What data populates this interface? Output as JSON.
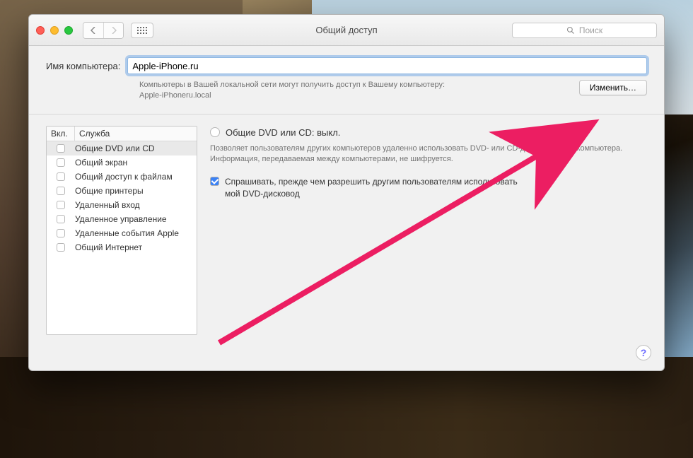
{
  "titlebar": {
    "title": "Общий доступ",
    "search_placeholder": "Поиск"
  },
  "computer": {
    "label": "Имя компьютера:",
    "value": "Apple-iPhone.ru",
    "description": "Компьютеры в Вашей локальной сети могут получить доступ к Вашему компьютеру: Apple-iPhoneru.local",
    "change_button": "Изменить…"
  },
  "list": {
    "header_on": "Вкл.",
    "header_service": "Служба",
    "items": [
      {
        "label": "Общие DVD или CD",
        "checked": false,
        "selected": true
      },
      {
        "label": "Общий экран",
        "checked": false,
        "selected": false
      },
      {
        "label": "Общий доступ к файлам",
        "checked": false,
        "selected": false
      },
      {
        "label": "Общие принтеры",
        "checked": false,
        "selected": false
      },
      {
        "label": "Удаленный вход",
        "checked": false,
        "selected": false
      },
      {
        "label": "Удаленное управление",
        "checked": false,
        "selected": false
      },
      {
        "label": "Удаленные события Apple",
        "checked": false,
        "selected": false
      },
      {
        "label": "Общий Интернет",
        "checked": false,
        "selected": false
      }
    ]
  },
  "detail": {
    "status_title": "Общие DVD или CD: выкл.",
    "status_description": "Позволяет пользователям других компьютеров удаленно использовать DVD- или CD-дисковод этого компьютера. Информация, передаваемая между компьютерами, не шифруется.",
    "ask_checked": true,
    "ask_label": "Спрашивать, прежде чем разрешить другим пользователям использовать мой DVD-дисковод"
  },
  "help_tooltip": "?"
}
